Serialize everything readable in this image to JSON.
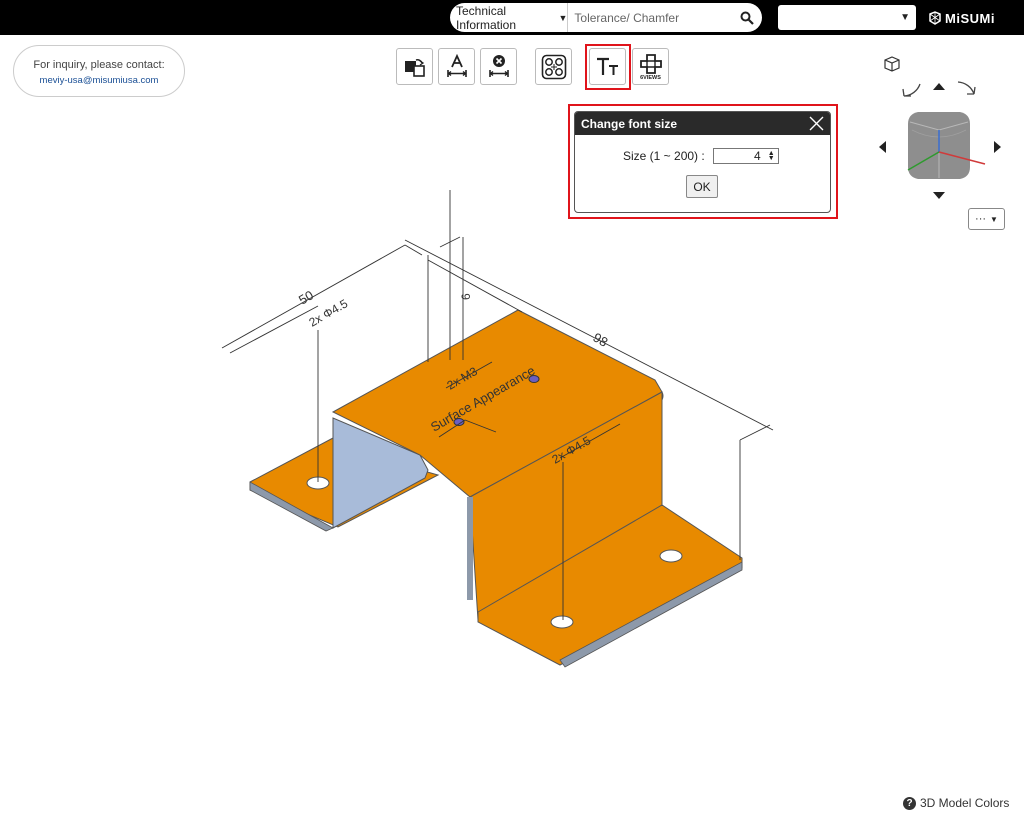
{
  "header": {
    "search_category": "Technical Information",
    "search_placeholder": "Tolerance/ Chamfer",
    "language_value": "",
    "logo_text": "MiSUMi"
  },
  "inquiry": {
    "text": "For inquiry, please contact:",
    "email": "meviy-usa@misumiusa.com"
  },
  "toolbar": {
    "views_label": "6VIEWS"
  },
  "dialog": {
    "title": "Change font size",
    "size_label": "Size (1 ~ 200) :",
    "size_value": "4",
    "ok_label": "OK"
  },
  "view_cube": {
    "more_label": "···"
  },
  "model": {
    "dims": {
      "d50": "50",
      "hole45_top": "2x Φ4.5",
      "d98": "98",
      "d6": "6",
      "m3": "2x M3",
      "surface": "Surface Appearance",
      "hole45_right": "2x Φ4.5"
    },
    "colors": {
      "surface": "#e88a00",
      "side": "#a8bbd9"
    }
  },
  "footer": {
    "colors_label": "3D Model Colors"
  }
}
